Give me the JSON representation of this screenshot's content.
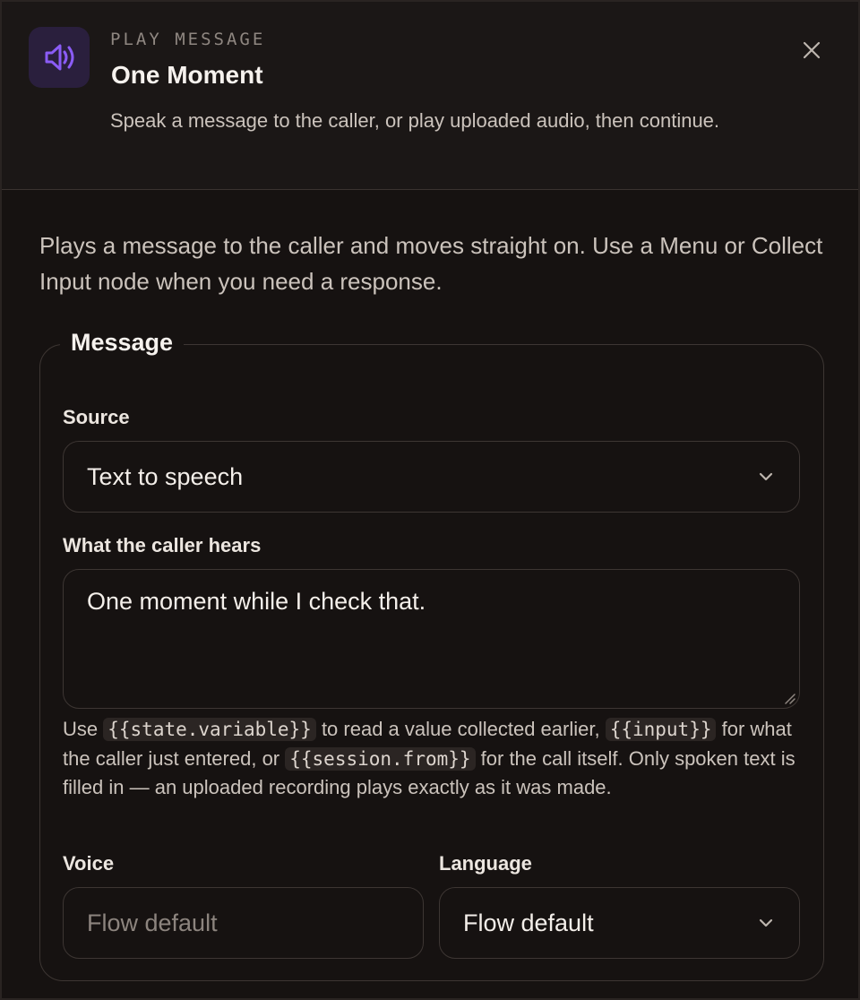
{
  "header": {
    "eyebrow": "PLAY MESSAGE",
    "title": "One Moment",
    "subtitle": "Speak a message to the caller, or play uploaded audio, then continue.",
    "icon": "speaker-icon",
    "close_icon": "close-icon"
  },
  "intro": "Plays a message to the caller and moves straight on. Use a Menu or Collect Input node when you need a response.",
  "message": {
    "legend": "Message",
    "source": {
      "label": "Source",
      "value": "Text to speech"
    },
    "speech": {
      "label": "What the caller hears",
      "value": "One moment while I check that."
    },
    "help": {
      "part1": "Use ",
      "code1": "{{state.variable}}",
      "part2": " to read a value collected earlier, ",
      "code2": "{{input}}",
      "part3": " for what the caller just entered, or ",
      "code3": "{{session.from}}",
      "part4": " for the call itself. Only spoken text is filled in — an uploaded recording plays exactly as it was made."
    },
    "voice": {
      "label": "Voice",
      "placeholder": "Flow default"
    },
    "language": {
      "label": "Language",
      "value": "Flow default"
    }
  },
  "colors": {
    "background": "#161211",
    "accent": "#8b5cf6",
    "icon_bg": "#2a1f3d"
  }
}
